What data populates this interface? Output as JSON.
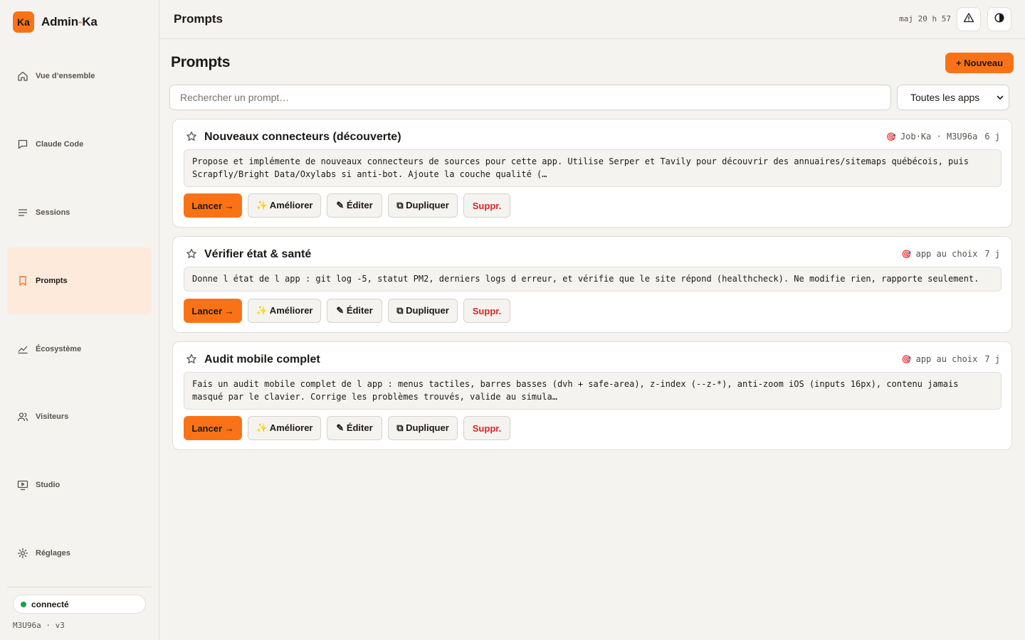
{
  "brand": {
    "logo": "Ka",
    "name_prefix": "Admin",
    "name_dash": "-",
    "name_suffix": "Ka"
  },
  "sidebar": {
    "items": [
      {
        "label": "Vue d’ensemble",
        "icon": "home-icon"
      },
      {
        "label": "Claude Code",
        "icon": "chat-bubble-icon"
      },
      {
        "label": "Sessions",
        "icon": "list-icon"
      },
      {
        "label": "Prompts",
        "icon": "bookmark-icon",
        "active": true
      },
      {
        "label": "Écosystème",
        "icon": "chart-line-icon"
      },
      {
        "label": "Visiteurs",
        "icon": "users-icon"
      },
      {
        "label": "Studio",
        "icon": "monitor-play-icon"
      },
      {
        "label": "Réglages",
        "icon": "gear-icon"
      }
    ],
    "status": {
      "label": "connecté",
      "color": "#16a34a"
    },
    "version": "M3U96a · v3"
  },
  "topbar": {
    "title": "Prompts",
    "updated": "maj 20 h 57",
    "alert_icon": "warning-triangle-icon",
    "theme_icon": "contrast-icon"
  },
  "main": {
    "title": "Prompts",
    "new_button": "+ Nouveau",
    "search_placeholder": "Rechercher un prompt…",
    "filter_selected": "Toutes les apps"
  },
  "actions": {
    "launch": "Lancer →",
    "improve": "✨ Améliorer",
    "edit": "✎ Éditer",
    "duplicate": "⧉ Dupliquer",
    "delete": "Suppr."
  },
  "prompts": [
    {
      "title": "Nouveaux connecteurs (découverte)",
      "target": "Job·Ka · M3U96a",
      "age": "6 j",
      "body": "Propose et implémente de nouveaux connecteurs de sources pour cette app. Utilise Serper et Tavily pour découvrir des annuaires/sitemaps québécois, puis Scrapfly/Bright Data/Oxylabs si anti-bot. Ajoute la couche qualité (…"
    },
    {
      "title": "Vérifier état & santé",
      "target": "app au choix",
      "age": "7 j",
      "body": "Donne l état de l app : git log -5, statut PM2, derniers logs d erreur, et vérifie que le site répond (healthcheck). Ne modifie rien, rapporte seulement."
    },
    {
      "title": "Audit mobile complet",
      "target": "app au choix",
      "age": "7 j",
      "body": "Fais un audit mobile complet de l app : menus tactiles, barres basses (dvh + safe-area), z-index (--z-*), anti-zoom iOS (inputs 16px), contenu jamais masqué par le clavier. Corrige les problèmes trouvés, valide au simula…"
    }
  ],
  "colors": {
    "accent": "#f97316",
    "danger": "#dc2626",
    "active_bg": "#fdeadb"
  }
}
